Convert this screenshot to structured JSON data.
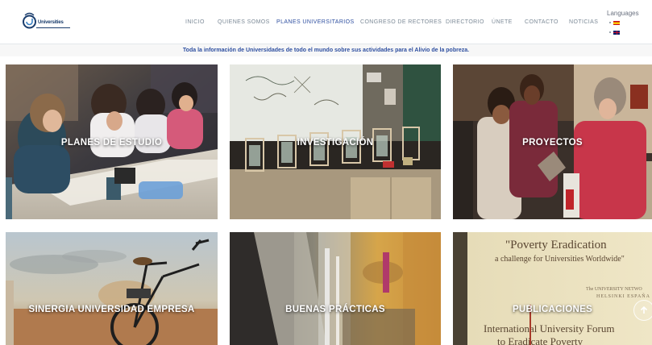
{
  "header": {
    "logo_text": "Universities",
    "nav": [
      {
        "label": "INICIO",
        "active": false
      },
      {
        "label": "QUIENES SOMOS",
        "active": false
      },
      {
        "label": "PLANES UNIVERSITARIOS",
        "active": true
      },
      {
        "label": "CONGRESO DE RECTORES",
        "active": false
      },
      {
        "label": "DIRECTORIO",
        "active": false
      },
      {
        "label": "ÚNETE",
        "active": false
      },
      {
        "label": "CONTACTO",
        "active": false
      },
      {
        "label": "NOTICIAS",
        "active": false
      }
    ],
    "languages_title": "Languages",
    "languages": [
      {
        "flag": "spain-flag"
      },
      {
        "flag": "uk-flag"
      }
    ]
  },
  "tagline": "Toda la información de Universidades de todo el mundo sobre sus actividades para el Alivio de la pobreza.",
  "tiles": [
    {
      "label": "PLANES DE ESTUDIO"
    },
    {
      "label": "INVESTIGACIÓN"
    },
    {
      "label": "PROYECTOS"
    },
    {
      "label": "SINERGIA UNIVERSIDAD EMPRESA"
    },
    {
      "label": "BUENAS PRÁCTICAS"
    },
    {
      "label": "PUBLICACIONES"
    }
  ],
  "publicaciones_poster": {
    "line1": "\"Poverty Eradication",
    "line2": "a challenge for Universities Worldwide\"",
    "line3": "The UNIVERSITY NETWO",
    "line4": "HELSINKI  ESPAÑA",
    "line5": "International University Forum",
    "line6": "to Eradicate Poverty"
  },
  "scroll_top_icon": "arrow-up-icon"
}
